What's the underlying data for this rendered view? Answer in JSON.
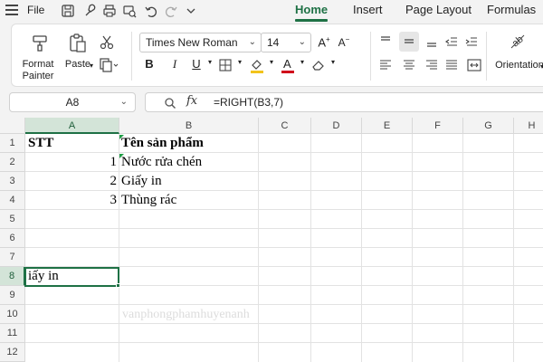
{
  "menubar": {
    "file_label": "File",
    "tabs": [
      {
        "label": "Home",
        "active": true
      },
      {
        "label": "Insert",
        "active": false
      },
      {
        "label": "Page Layout",
        "active": false
      },
      {
        "label": "Formulas",
        "active": false
      }
    ]
  },
  "ribbon": {
    "format_painter": {
      "line1": "Format",
      "line2": "Painter"
    },
    "paste_label": "Paste",
    "font_name": "Times New Roman",
    "font_size": "14",
    "bold": "B",
    "italic": "I",
    "underline": "U",
    "orientation_label": "Orientation"
  },
  "formula_bar": {
    "name_box": "A8",
    "fx_label": "fx",
    "formula": "=RIGHT(B3,7)"
  },
  "sheet": {
    "columns": [
      "A",
      "B",
      "C",
      "D",
      "E",
      "F",
      "G",
      "H"
    ],
    "selected_column": "A",
    "rows": [
      "1",
      "2",
      "3",
      "4",
      "5",
      "6",
      "7",
      "8",
      "9",
      "10",
      "11",
      "12"
    ],
    "selected_row": "8",
    "cells": {
      "A1": "STT",
      "B1": "Tên sản phẩm",
      "A2": "1",
      "B2": "Nước rửa chén",
      "A3": "2",
      "B3": "Giấy in",
      "A4": "3",
      "B4": "Thùng rác",
      "A8": "iấy in"
    },
    "watermark": "vanphongphamhuyenanh"
  },
  "colors": {
    "accent": "#1e7145",
    "header_selected": "#d3e4d8"
  },
  "icons": [
    "hamburger-icon",
    "save-icon",
    "brush-icon",
    "print-icon",
    "print-preview-icon",
    "undo-icon",
    "redo-icon",
    "customize-icon",
    "format-painter-icon",
    "paste-icon",
    "cut-icon",
    "copy-icon",
    "search-icon"
  ]
}
